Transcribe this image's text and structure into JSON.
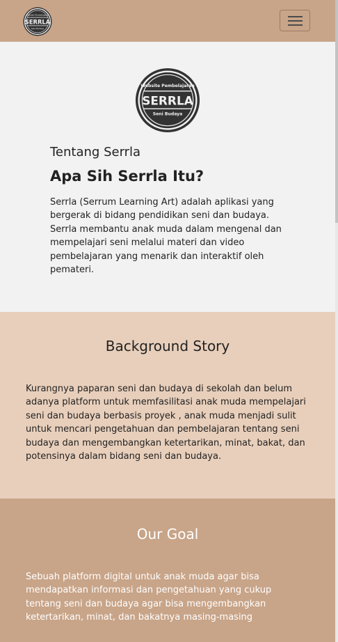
{
  "colors": {
    "navbar": "#c8a488",
    "about_bg": "#f2f2f2",
    "story_bg": "#e8cfbb",
    "goal_bg": "#c8a488",
    "logo_dark": "#333333"
  },
  "logo": {
    "top_text": "Website Pembelajaran",
    "name": "SERRLA",
    "bottom_text": "Seni Budaya"
  },
  "navbar": {
    "menu_icon": "hamburger-icon"
  },
  "about": {
    "subtitle": "Tentang Serrla",
    "title": "Apa Sih Serrla Itu?",
    "text": "Serrla (Serrum Learning Art) adalah aplikasi yang bergerak di bidang pendidikan seni dan budaya. Serrla membantu anak muda dalam mengenal dan mempelajari seni melalui materi dan video pembelajaran yang menarik dan interaktif oleh pemateri."
  },
  "story": {
    "title": "Background Story",
    "text": "Kurangnya paparan seni dan budaya di sekolah dan belum adanya platform untuk memfasilitasi anak muda mempelajari seni dan budaya berbasis proyek , anak muda menjadi sulit untuk mencari pengetahuan dan pembelajaran tentang seni budaya dan mengembangkan ketertarikan, minat, bakat, dan potensinya dalam bidang seni dan budaya."
  },
  "goal": {
    "title": "Our Goal",
    "text": "Sebuah platform digital untuk anak muda agar bisa mendapatkan informasi dan pengetahuan yang cukup tentang seni dan budaya agar bisa mengembangkan ketertarikan, minat, dan bakatnya masing-masing"
  }
}
